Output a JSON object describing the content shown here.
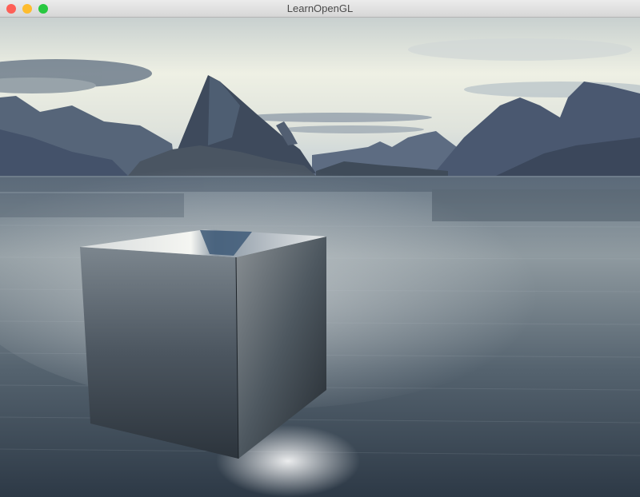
{
  "window": {
    "title": "LearnOpenGL",
    "controls": {
      "close_color": "#fe5f57",
      "minimize_color": "#febc2e",
      "maximize_color": "#28c840"
    }
  },
  "scene": {
    "description_icons": [
      "skybox-mountains",
      "water-plane",
      "reflective-cube"
    ],
    "colors": {
      "sky_top": "#9fb4c8",
      "sky_mid": "#eef0e6",
      "horizon": "#c9d3d6",
      "mountain": "#3f4c5e",
      "mountain_dark": "#2b3542",
      "water_top": "#5a6a7a",
      "water_bottom": "#2c3a48"
    }
  }
}
